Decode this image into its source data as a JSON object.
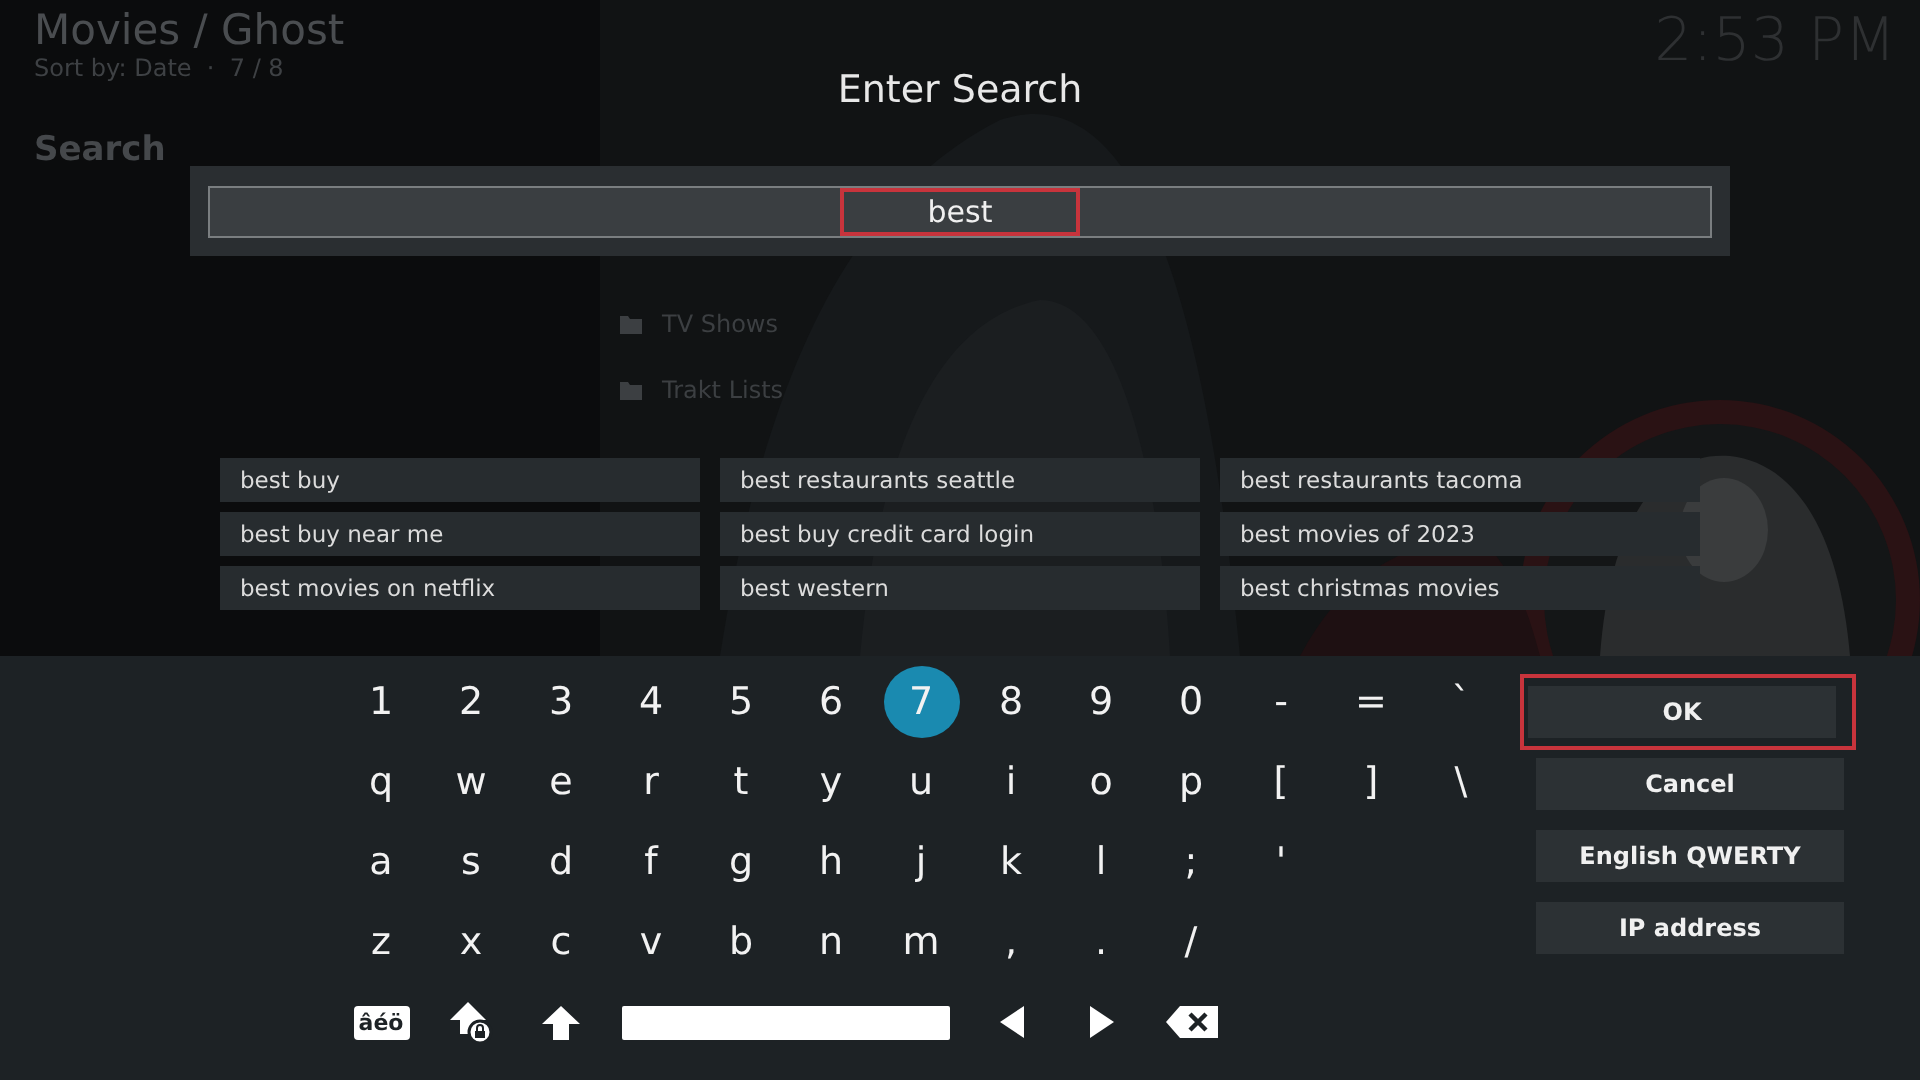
{
  "header": {
    "title": "Movies / Ghost",
    "sort": "Sort by: Date  ·  7 / 8",
    "clock": "2:53 PM"
  },
  "side_heading": "Search",
  "background_list": [
    {
      "label": "TV Shows"
    },
    {
      "label": "Trakt Lists"
    }
  ],
  "dialog": {
    "title": "Enter Search",
    "input": {
      "value": "best"
    },
    "suggestions": [
      {
        "label": "best buy",
        "selected": false
      },
      {
        "label": "best restaurants seattle",
        "selected": false
      },
      {
        "label": "best restaurants tacoma",
        "selected": false
      },
      {
        "label": "best buy near me",
        "selected": false
      },
      {
        "label": "best buy credit card login",
        "selected": false
      },
      {
        "label": "best movies of 2023",
        "selected": false
      },
      {
        "label": "best movies on netflix",
        "selected": false
      },
      {
        "label": "best western",
        "selected": false
      },
      {
        "label": "best christmas movies",
        "selected": false
      }
    ],
    "keyboard": {
      "rows": [
        [
          {
            "label": "1",
            "selected": false
          },
          {
            "label": "2",
            "selected": false
          },
          {
            "label": "3",
            "selected": false
          },
          {
            "label": "4",
            "selected": false
          },
          {
            "label": "5",
            "selected": false
          },
          {
            "label": "6",
            "selected": false
          },
          {
            "label": "7",
            "selected": true
          },
          {
            "label": "8",
            "selected": false
          },
          {
            "label": "9",
            "selected": false
          },
          {
            "label": "0",
            "selected": false
          },
          {
            "label": "-",
            "selected": false
          },
          {
            "label": "=",
            "selected": false
          },
          {
            "label": "`",
            "selected": false
          }
        ],
        [
          {
            "label": "q",
            "selected": false
          },
          {
            "label": "w",
            "selected": false
          },
          {
            "label": "e",
            "selected": false
          },
          {
            "label": "r",
            "selected": false
          },
          {
            "label": "t",
            "selected": false
          },
          {
            "label": "y",
            "selected": false
          },
          {
            "label": "u",
            "selected": false
          },
          {
            "label": "i",
            "selected": false
          },
          {
            "label": "o",
            "selected": false
          },
          {
            "label": "p",
            "selected": false
          },
          {
            "label": "[",
            "selected": false
          },
          {
            "label": "]",
            "selected": false
          },
          {
            "label": "\\",
            "selected": false
          }
        ],
        [
          {
            "label": "a",
            "selected": false
          },
          {
            "label": "s",
            "selected": false
          },
          {
            "label": "d",
            "selected": false
          },
          {
            "label": "f",
            "selected": false
          },
          {
            "label": "g",
            "selected": false
          },
          {
            "label": "h",
            "selected": false
          },
          {
            "label": "j",
            "selected": false
          },
          {
            "label": "k",
            "selected": false
          },
          {
            "label": "l",
            "selected": false
          },
          {
            "label": ";",
            "selected": false
          },
          {
            "label": "'",
            "selected": false
          }
        ],
        [
          {
            "label": "z",
            "selected": false
          },
          {
            "label": "x",
            "selected": false
          },
          {
            "label": "c",
            "selected": false
          },
          {
            "label": "v",
            "selected": false
          },
          {
            "label": "b",
            "selected": false
          },
          {
            "label": "n",
            "selected": false
          },
          {
            "label": "m",
            "selected": false
          },
          {
            "label": ",",
            "selected": false
          },
          {
            "label": ".",
            "selected": false
          },
          {
            "label": "/",
            "selected": false
          }
        ]
      ],
      "special_keys": [
        {
          "kind": "accents",
          "label": "âéö"
        },
        {
          "kind": "capslock"
        },
        {
          "kind": "shift"
        },
        {
          "kind": "space"
        },
        {
          "kind": "left"
        },
        {
          "kind": "right"
        },
        {
          "kind": "backspace"
        }
      ]
    },
    "buttons": [
      {
        "label": "OK",
        "focused": true
      },
      {
        "label": "Cancel",
        "focused": false
      },
      {
        "label": "English QWERTY",
        "focused": false
      },
      {
        "label": "IP address",
        "focused": false
      }
    ]
  }
}
